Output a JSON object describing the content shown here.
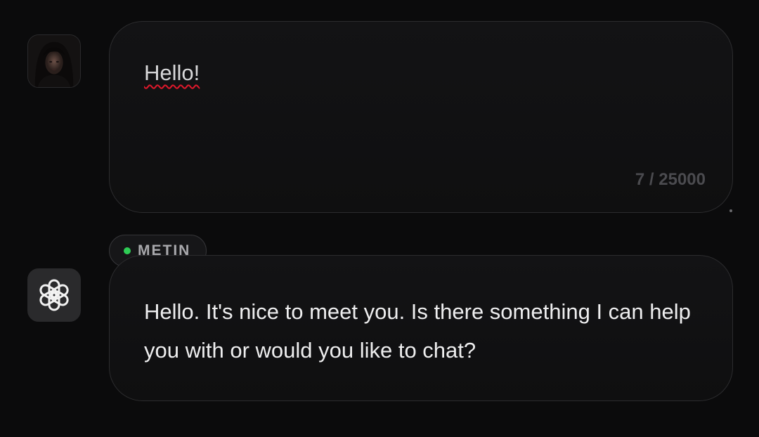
{
  "user": {
    "avatar_icon": "user-avatar-photo"
  },
  "composer": {
    "text": "Hello!",
    "counter": "7 / 25000"
  },
  "assistant": {
    "avatar_icon": "openai-logo-icon",
    "model_tag": "METIN",
    "status_color": "#2ecc55",
    "reply": "Hello. It's nice to meet you. Is there something I can help you with or would you like to chat?"
  },
  "colors": {
    "background": "#0b0b0c",
    "bubble_border": "#2c2c2e",
    "spellcheck_underline": "#e0182b"
  }
}
